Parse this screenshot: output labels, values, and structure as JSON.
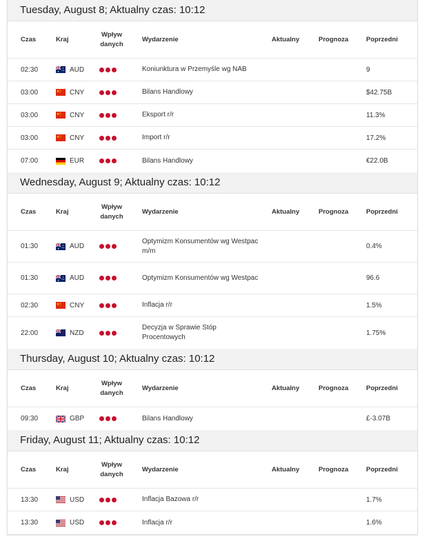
{
  "columns": {
    "time": "Czas",
    "country": "Kraj",
    "impact_line1": "Wpływ",
    "impact_line2": "danych",
    "event": "Wydarzenie",
    "actual": "Aktualny",
    "forecast": "Prognoza",
    "previous": "Poprzedni"
  },
  "impact_color": "#c8102e",
  "days": [
    {
      "title": "Tuesday, August 8; Aktualny czas: 10:12",
      "rows": [
        {
          "time": "02:30",
          "flag": "flag-australia-icon",
          "currency": "AUD",
          "event": "Koniunktura w Przemyśle wg NAB",
          "actual": "",
          "forecast": "",
          "previous": "9"
        },
        {
          "time": "03:00",
          "flag": "flag-china-icon",
          "currency": "CNY",
          "event": "Bilans Handlowy",
          "actual": "",
          "forecast": "",
          "previous": "$42.75B"
        },
        {
          "time": "03:00",
          "flag": "flag-china-icon",
          "currency": "CNY",
          "event": "Eksport r/r",
          "actual": "",
          "forecast": "",
          "previous": "11.3%"
        },
        {
          "time": "03:00",
          "flag": "flag-china-icon",
          "currency": "CNY",
          "event": "Import r/r",
          "actual": "",
          "forecast": "",
          "previous": "17.2%"
        },
        {
          "time": "07:00",
          "flag": "flag-germany-icon",
          "currency": "EUR",
          "event": "Bilans Handlowy",
          "actual": "",
          "forecast": "",
          "previous": "€22.0B"
        }
      ]
    },
    {
      "title": "Wednesday, August 9; Aktualny czas: 10:12",
      "rows": [
        {
          "time": "01:30",
          "flag": "flag-australia-icon",
          "currency": "AUD",
          "event": "Optymizm Konsumentów wg Westpac m/m",
          "actual": "",
          "forecast": "",
          "previous": "0.4%"
        },
        {
          "time": "01:30",
          "flag": "flag-australia-icon",
          "currency": "AUD",
          "event": "Optymizm Konsumentów wg Westpac",
          "actual": "",
          "forecast": "",
          "previous": "96.6"
        },
        {
          "time": "02:30",
          "flag": "flag-china-icon",
          "currency": "CNY",
          "event": "Inflacja r/r",
          "actual": "",
          "forecast": "",
          "previous": "1.5%"
        },
        {
          "time": "22:00",
          "flag": "flag-new-zealand-icon",
          "currency": "NZD",
          "event": "Decyzja w Sprawie Stóp Procentowych",
          "actual": "",
          "forecast": "",
          "previous": "1.75%"
        }
      ]
    },
    {
      "title": "Thursday, August 10; Aktualny czas: 10:12",
      "rows": [
        {
          "time": "09:30",
          "flag": "flag-united-kingdom-icon",
          "currency": "GBP",
          "event": "Bilans Handlowy",
          "actual": "",
          "forecast": "",
          "previous": "£-3.07B"
        }
      ]
    },
    {
      "title": "Friday, August 11; Aktualny czas: 10:12",
      "rows": [
        {
          "time": "13:30",
          "flag": "flag-usa-icon",
          "currency": "USD",
          "event": "Inflacja Bazowa r/r",
          "actual": "",
          "forecast": "",
          "previous": "1.7%"
        },
        {
          "time": "13:30",
          "flag": "flag-usa-icon",
          "currency": "USD",
          "event": "Inflacja r/r",
          "actual": "",
          "forecast": "",
          "previous": "1.6%"
        }
      ]
    }
  ]
}
